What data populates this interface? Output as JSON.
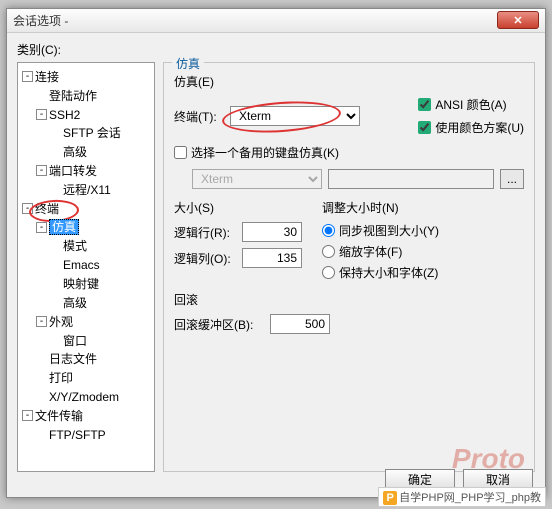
{
  "window": {
    "title": "会话选项 -"
  },
  "category_label": "类别(C):",
  "tree": {
    "connection": "连接",
    "login": "登陆动作",
    "ssh2": "SSH2",
    "sftp": "SFTP 会话",
    "advanced1": "高级",
    "portfwd": "端口转发",
    "remotex11": "远程/X11",
    "terminal": "终端",
    "emu": "仿真",
    "mode": "模式",
    "emacs": "Emacs",
    "mapkey": "映射键",
    "advanced2": "高级",
    "appearance": "外观",
    "window": "窗口",
    "logfile": "日志文件",
    "print": "打印",
    "xyz": "X/Y/Zmodem",
    "filetrans": "文件传输",
    "ftpsftp": "FTP/SFTP"
  },
  "panel": {
    "title": "仿真",
    "emu_section": "仿真(E)",
    "terminal_label": "终端(T):",
    "terminal_value": "Xterm",
    "ansi_color": "ANSI 颜色(A)",
    "use_scheme": "使用颜色方案(U)",
    "alt_keyboard": "选择一个备用的键盘仿真(K)",
    "alt_combo": "Xterm",
    "browse": "...",
    "size_title": "大小(S)",
    "rows_label": "逻辑行(R):",
    "rows_value": "30",
    "cols_label": "逻辑列(O):",
    "cols_value": "135",
    "resize_title": "调整大小时(N)",
    "sync": "同步视图到大小(Y)",
    "zoomfont": "缩放字体(F)",
    "keepsize": "保持大小和字体(Z)",
    "scrollback_title": "回滚",
    "scrollback_label": "回滚缓冲区(B):",
    "scrollback_value": "500"
  },
  "buttons": {
    "ok": "确定",
    "cancel": "取消"
  },
  "footer": "自学PHP网_PHP学习_php教"
}
